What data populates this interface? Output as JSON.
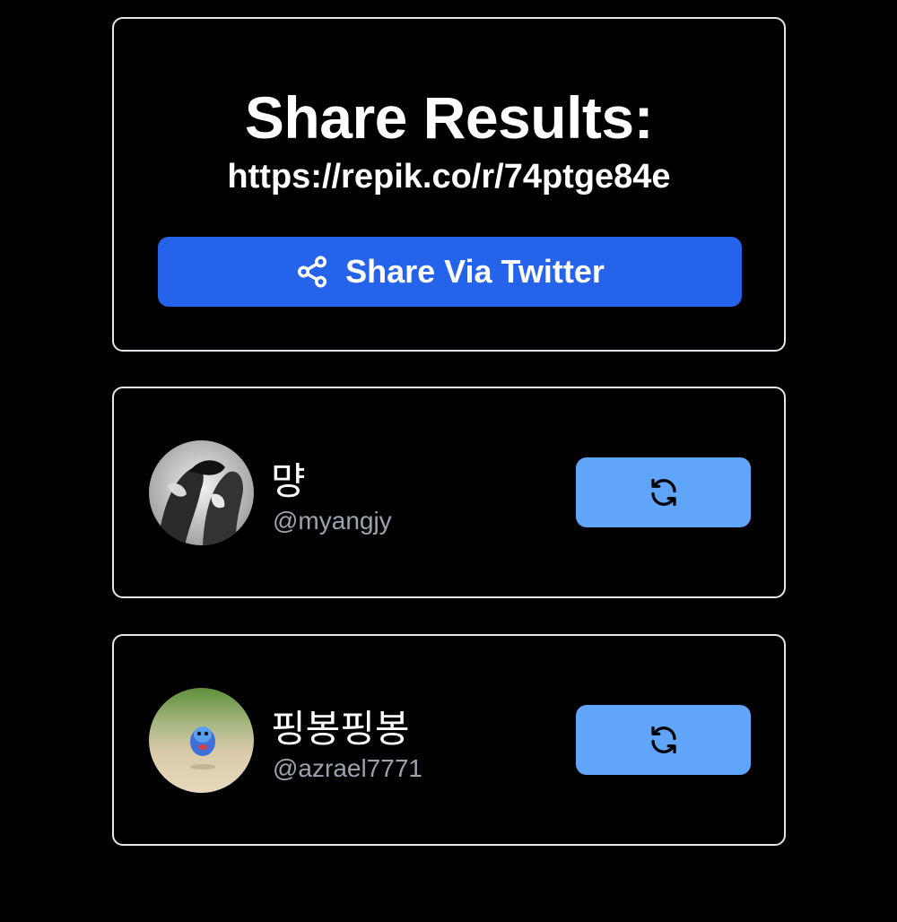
{
  "share": {
    "title": "Share Results:",
    "url": "https://repik.co/r/74ptge84e",
    "twitter_button_label": "Share Via Twitter",
    "twitter_button_icon": "share-icon",
    "button_color": "#2563eb"
  },
  "users": [
    {
      "name": "먕",
      "handle": "@myangjy",
      "avatar": "avatar-bw-photo",
      "action_icon": "refresh-icon"
    },
    {
      "name": "핑봉핑봉",
      "handle": "@azrael7771",
      "avatar": "avatar-blue-creature",
      "action_icon": "refresh-icon"
    }
  ],
  "colors": {
    "background": "#000000",
    "card_border": "#e5e7eb",
    "refresh_button": "#60a5fa",
    "handle_text": "#9ca3af"
  }
}
